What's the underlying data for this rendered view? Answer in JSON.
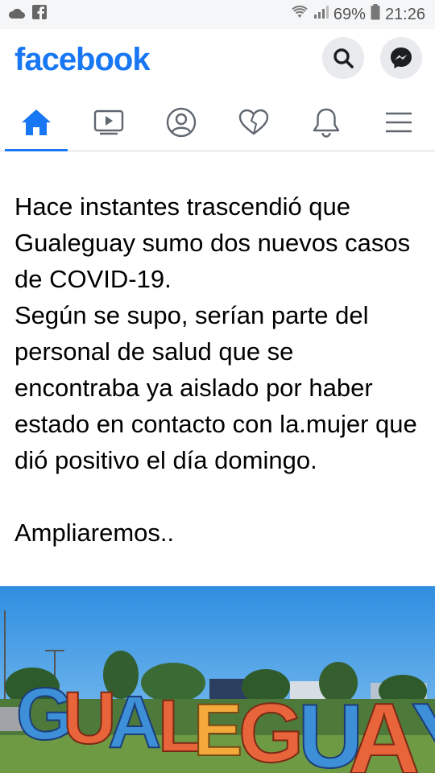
{
  "status_bar": {
    "icons": [
      "cloud-icon",
      "facebook-small-icon",
      "wifi-icon",
      "signal-icon",
      "battery-icon"
    ],
    "battery": "69%",
    "time": "21:26"
  },
  "header": {
    "logo": "facebook",
    "brand_color": "#1877f2"
  },
  "tabs": [
    {
      "icon": "home-icon",
      "active": true
    },
    {
      "icon": "watch-video-icon",
      "active": false
    },
    {
      "icon": "profile-icon",
      "active": false
    },
    {
      "icon": "dating-heart-icon",
      "active": false
    },
    {
      "icon": "notifications-bell-icon",
      "active": false
    },
    {
      "icon": "menu-icon",
      "active": false
    }
  ],
  "post": {
    "text": "Hace instantes trascendió que Gualeguay sumo dos nuevos casos de COVID-19.\nSegún se supo, serían parte del personal de salud que se encontraba ya aislado por haber estado en contacto con la.mujer que dió positivo el día domingo.\n\nAmpliaremos.."
  },
  "photo": {
    "sign_letters": [
      "G",
      "U",
      "A",
      "L",
      "E",
      "G",
      "U",
      "A",
      "Y"
    ]
  }
}
